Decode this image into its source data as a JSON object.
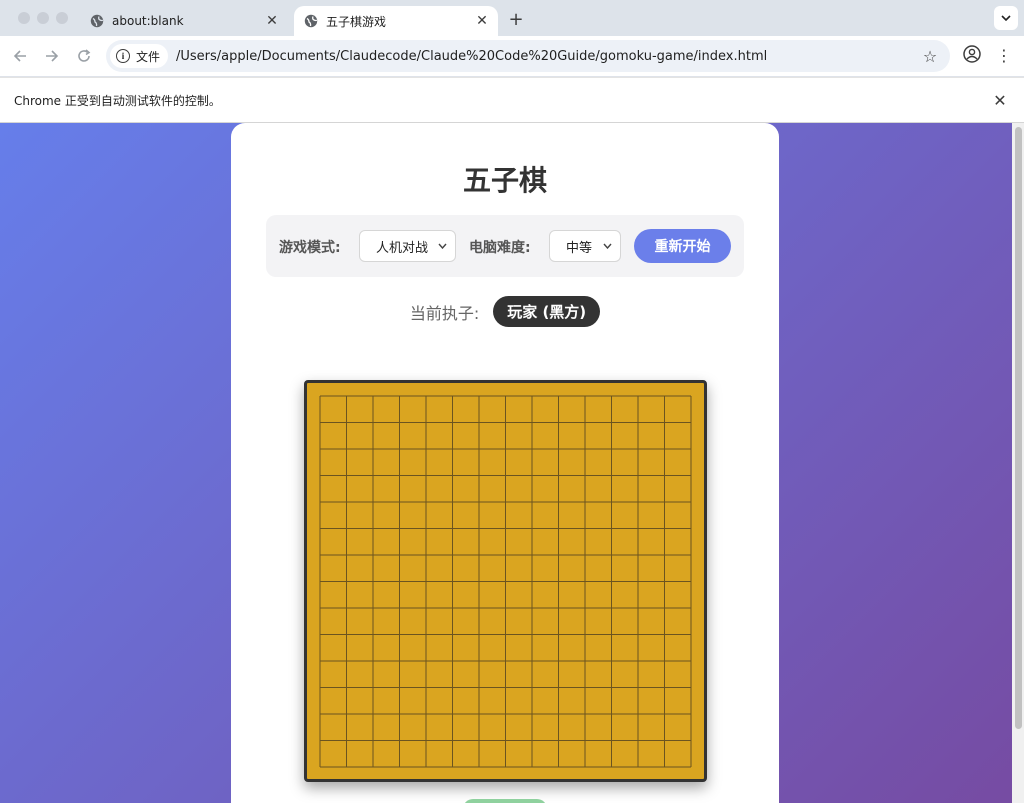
{
  "browser": {
    "tabs": [
      {
        "title": "about:blank",
        "active": false
      },
      {
        "title": "五子棋游戏",
        "active": true
      }
    ],
    "address": {
      "chip_label": "文件",
      "url": "/Users/apple/Documents/Claudecode/Claude%20Code%20Guide/gomoku-game/index.html"
    },
    "infobar_message": "Chrome 正受到自动测试软件的控制。"
  },
  "page": {
    "title": "五子棋",
    "controls": {
      "mode_label": "游戏模式:",
      "mode_value": "人机对战",
      "difficulty_label": "电脑难度:",
      "difficulty_value": "中等",
      "restart_label": "重新开始"
    },
    "turn": {
      "label": "当前执子:",
      "player": "玩家 (黑方)"
    },
    "board": {
      "size": 15,
      "stones": []
    }
  },
  "colors": {
    "background_gradient": [
      "#667eea",
      "#764ba2"
    ],
    "board": "#daa520",
    "accent": "#6b7fea",
    "badge": "#333333"
  },
  "icons": [
    "globe-icon",
    "close-icon",
    "plus-icon",
    "chevron-down-icon",
    "back-icon",
    "forward-icon",
    "reload-icon",
    "info-icon",
    "star-icon",
    "profile-icon",
    "kebab-menu-icon"
  ]
}
